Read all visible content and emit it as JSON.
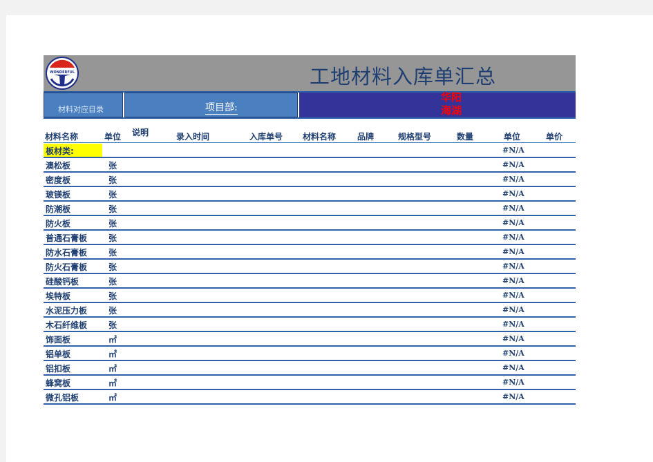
{
  "header": {
    "logo_text": "WONDERFUL",
    "title": "工地材料入库单汇总",
    "catalog_label": "材料对应目录",
    "project_label": "项目部:",
    "red_text": "华阳 海湖"
  },
  "columns": [
    "材料名称",
    "单位",
    "说明",
    "录入时间",
    "入库单号",
    "材料名称",
    "品牌",
    "规格型号",
    "数量",
    "单位",
    "单价"
  ],
  "category": {
    "name": "板材类:",
    "value": "#N/A"
  },
  "rows": [
    {
      "name": "澳松板",
      "unit": "张",
      "value": "#N/A"
    },
    {
      "name": "密度板",
      "unit": "张",
      "value": "#N/A"
    },
    {
      "name": "玻镁板",
      "unit": "张",
      "value": "#N/A"
    },
    {
      "name": "防潮板",
      "unit": "张",
      "value": "#N/A"
    },
    {
      "name": "防火板",
      "unit": "张",
      "value": "#N/A"
    },
    {
      "name": "普通石膏板",
      "unit": "张",
      "value": "#N/A"
    },
    {
      "name": "防水石膏板",
      "unit": "张",
      "value": "#N/A"
    },
    {
      "name": "防火石膏板",
      "unit": "张",
      "value": "#N/A"
    },
    {
      "name": "硅酸钙板",
      "unit": "张",
      "value": "#N/A"
    },
    {
      "name": "埃特板",
      "unit": "张",
      "value": "#N/A"
    },
    {
      "name": "水泥压力板",
      "unit": "张",
      "value": "#N/A"
    },
    {
      "name": "木石纤维板",
      "unit": "张",
      "value": "#N/A"
    },
    {
      "name": "饰面板",
      "unit": "㎡",
      "value": "#N/A"
    },
    {
      "name": "铝单板",
      "unit": "㎡",
      "value": "#N/A"
    },
    {
      "name": "铝扣板",
      "unit": "㎡",
      "value": "#N/A"
    },
    {
      "name": "蜂窝板",
      "unit": "㎡",
      "value": "#N/A"
    },
    {
      "name": "微孔铝板",
      "unit": "㎡",
      "value": "#N/A"
    }
  ]
}
